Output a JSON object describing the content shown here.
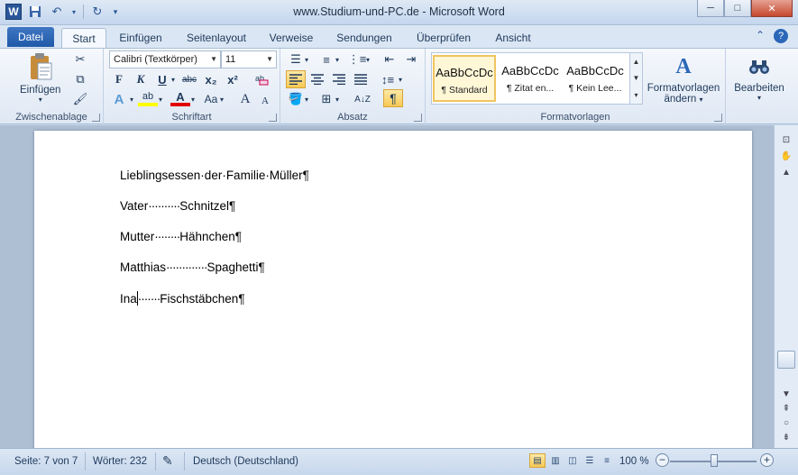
{
  "window": {
    "title": "www.Studium-und-PC.de  -  Microsoft Word",
    "qat": {
      "app_icon": "W",
      "save_icon": "save-icon",
      "undo_icon": "undo-icon",
      "redo_icon": "redo-icon"
    },
    "controls": {
      "minimize": "─",
      "maximize": "□",
      "close": "✕"
    }
  },
  "ribbon_tabs": {
    "file": "Datei",
    "tabs": [
      "Start",
      "Einfügen",
      "Seitenlayout",
      "Verweise",
      "Sendungen",
      "Überprüfen",
      "Ansicht"
    ],
    "active": "Start"
  },
  "ribbon": {
    "clipboard": {
      "paste_label": "Einfügen",
      "group_label": "Zwischenablage"
    },
    "font": {
      "font_name": "Calibri (Textkörper)",
      "font_size": "11",
      "bold": "F",
      "italic": "K",
      "underline": "U",
      "strike": "abc",
      "subscript": "x₂",
      "superscript": "x²",
      "grow": "A",
      "shrink": "A",
      "change_case": "Aa",
      "highlight": "ab",
      "font_color": "A",
      "group_label": "Schriftart"
    },
    "paragraph": {
      "group_label": "Absatz",
      "pilcrow": "¶"
    },
    "styles": {
      "items": [
        {
          "sample": "AaBbCcDc",
          "name": "¶ Standard"
        },
        {
          "sample": "AaBbCcDc",
          "name": "¶ Zitat en..."
        },
        {
          "sample": "AaBbCcDc",
          "name": "¶ Kein Lee..."
        }
      ],
      "change_styles_line1": "Formatvorlagen",
      "change_styles_line2": "ändern",
      "group_label": "Formatvorlagen"
    },
    "editing": {
      "label": "Bearbeiten"
    }
  },
  "document": {
    "lines": [
      {
        "a": "Lieblingsessen·der·Familie·Müller",
        "dots": "",
        "b": "",
        "pilcrow": "¶"
      },
      {
        "a": "Vater",
        "dots": "··········",
        "b": "Schnitzel",
        "pilcrow": "¶"
      },
      {
        "a": "Mutter",
        "dots": "········",
        "b": "Hähnchen",
        "pilcrow": "¶"
      },
      {
        "a": "Matthias",
        "dots": "·············",
        "b": "Spaghetti",
        "pilcrow": "¶"
      },
      {
        "a": "Ina",
        "dots": "·······",
        "b": "Fischstäbchen",
        "pilcrow": "¶"
      }
    ]
  },
  "statusbar": {
    "page": "Seite: 7 von 7",
    "words": "Wörter: 232",
    "language": "Deutsch (Deutschland)",
    "zoom": "100 %",
    "zoom_value": 100
  },
  "colors": {
    "accent": "#2b5797",
    "file_tab": "#2a63b3",
    "highlight": "#f8c955"
  }
}
